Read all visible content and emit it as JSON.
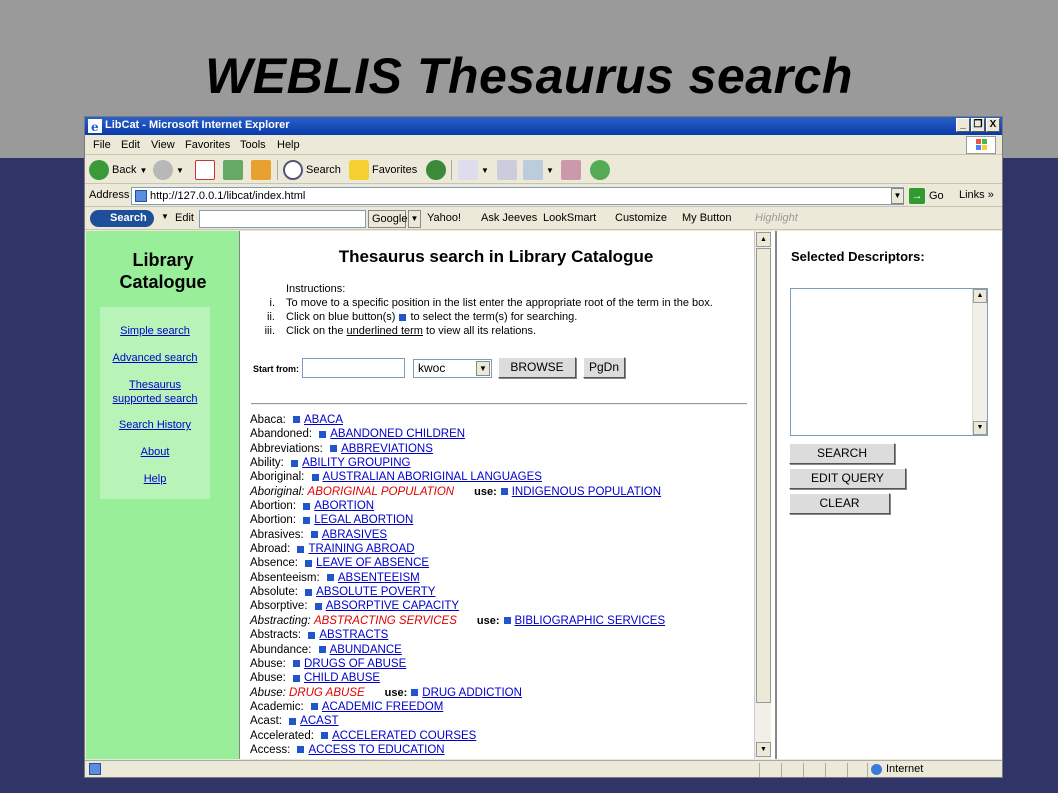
{
  "slide": {
    "title": "WEBLIS Thesaurus search"
  },
  "window": {
    "title": "LibCat - Microsoft Internet Explorer",
    "min": "_",
    "max": "❐",
    "close": "X"
  },
  "menu": [
    "File",
    "Edit",
    "View",
    "Favorites",
    "Tools",
    "Help"
  ],
  "toolbar": {
    "back": "Back",
    "search": "Search",
    "favorites": "Favorites"
  },
  "address": {
    "label": "Address",
    "url": "http://127.0.0.1/libcat/index.html",
    "go": "Go",
    "links": "Links"
  },
  "googlebar": {
    "mysearch": "Search",
    "edit": "Edit",
    "google": "Google",
    "items": [
      "Yahoo!",
      "Ask Jeeves",
      "LookSmart",
      "Customize",
      "My Button",
      "Highlight"
    ]
  },
  "left": {
    "title_line1": "Library",
    "title_line2": "Catalogue",
    "links": [
      "Simple search",
      "Advanced search",
      "Thesaurus",
      "supported search",
      "Search History",
      "About",
      "Help"
    ]
  },
  "main": {
    "title": "Thesaurus search in Library Catalogue",
    "instructions_label": "Instructions:",
    "instructions": [
      {
        "num": "i.",
        "text": "To move to a specific position in the list enter the appropriate root of the term in the box."
      },
      {
        "num": "ii.",
        "pre": "Click on blue button(s)",
        "post": "to select the term(s) for searching."
      },
      {
        "num": "iii.",
        "pre": "Click on the ",
        "link": "underlined term",
        "post": " to view all its relations."
      }
    ],
    "start_label": "Start from:",
    "select_value": "kwoc",
    "browse": "BROWSE",
    "pgdn": "PgDn",
    "use_label": "use:",
    "terms": [
      {
        "label": "Abaca:",
        "term": "ABACA"
      },
      {
        "label": "Abandoned:",
        "term": "ABANDONED CHILDREN"
      },
      {
        "label": "Abbreviations:",
        "term": "ABBREVIATIONS"
      },
      {
        "label": "Ability:",
        "term": "ABILITY GROUPING"
      },
      {
        "label": "Aboriginal:",
        "term": "AUSTRALIAN ABORIGINAL LANGUAGES"
      },
      {
        "label": "Aboriginal:",
        "red": "ABORIGINAL POPULATION",
        "use": "INDIGENOUS POPULATION"
      },
      {
        "label": "Abortion:",
        "term": "ABORTION"
      },
      {
        "label": "Abortion:",
        "term": "LEGAL ABORTION"
      },
      {
        "label": "Abrasives:",
        "term": "ABRASIVES"
      },
      {
        "label": "Abroad:",
        "term": "TRAINING ABROAD"
      },
      {
        "label": "Absence:",
        "term": "LEAVE OF ABSENCE"
      },
      {
        "label": "Absenteeism:",
        "term": "ABSENTEEISM"
      },
      {
        "label": "Absolute:",
        "term": "ABSOLUTE POVERTY"
      },
      {
        "label": "Absorptive:",
        "term": "ABSORPTIVE CAPACITY"
      },
      {
        "label": "Abstracting:",
        "red": "ABSTRACTING SERVICES",
        "use": "BIBLIOGRAPHIC SERVICES"
      },
      {
        "label": "Abstracts:",
        "term": "ABSTRACTS"
      },
      {
        "label": "Abundance:",
        "term": "ABUNDANCE"
      },
      {
        "label": "Abuse:",
        "term": "DRUGS OF ABUSE"
      },
      {
        "label": "Abuse:",
        "term": "CHILD ABUSE"
      },
      {
        "label": "Abuse:",
        "red": "DRUG ABUSE",
        "use": "DRUG ADDICTION"
      },
      {
        "label": "Academic:",
        "term": "ACADEMIC FREEDOM"
      },
      {
        "label": "Acast:",
        "term": "ACAST"
      },
      {
        "label": "Accelerated:",
        "term": "ACCELERATED COURSES"
      },
      {
        "label": "Access:",
        "term": "ACCESS TO EDUCATION"
      }
    ]
  },
  "right": {
    "title": "Selected Descriptors:",
    "search": "SEARCH",
    "edit_query": "EDIT QUERY",
    "clear": "CLEAR"
  },
  "status": {
    "zone": "Internet"
  }
}
